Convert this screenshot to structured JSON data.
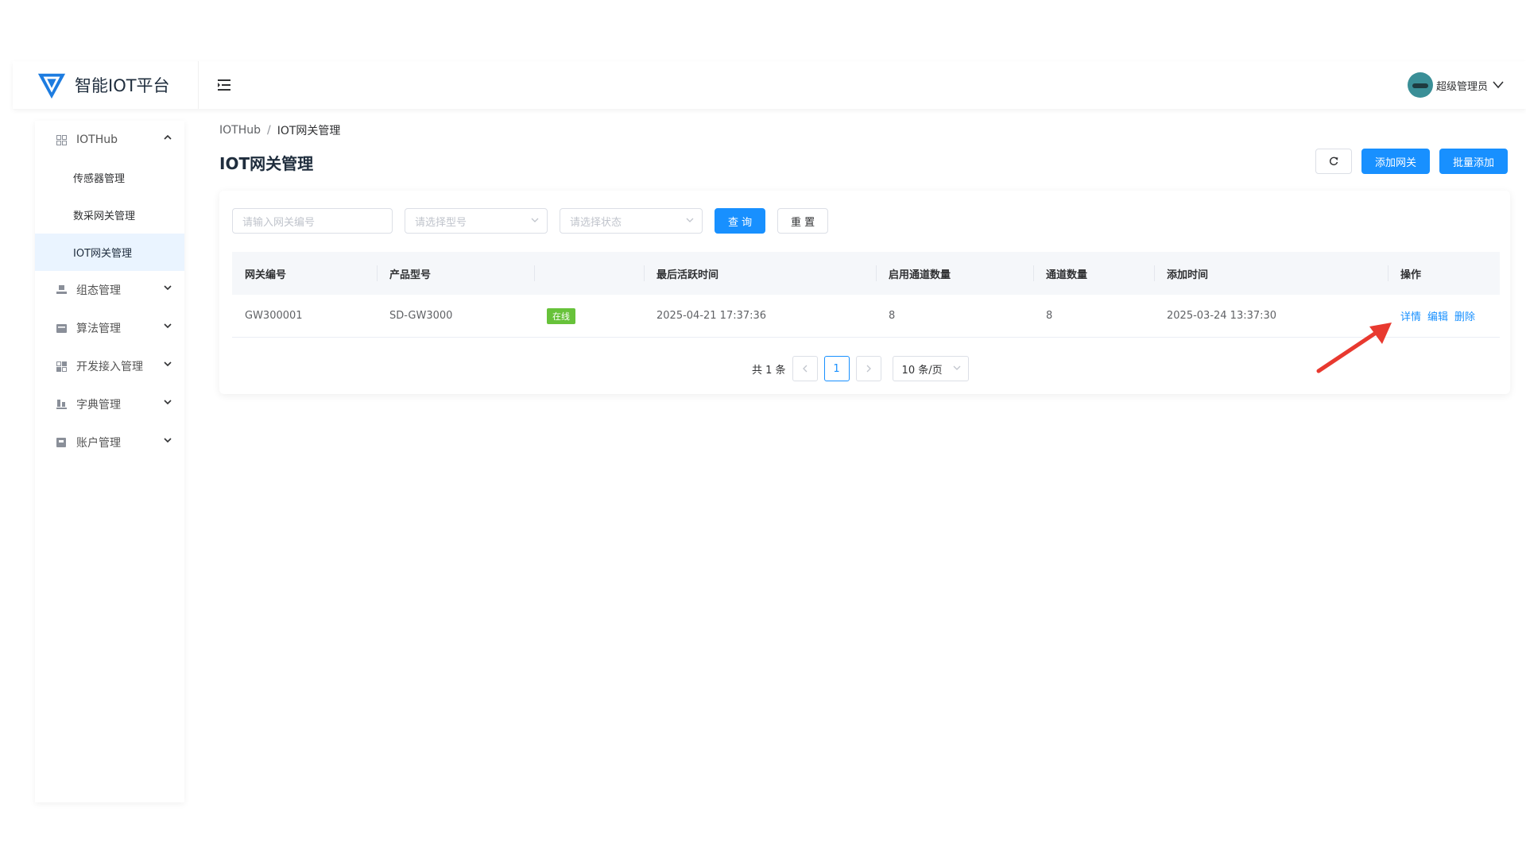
{
  "app": {
    "title": "智能IOT平台",
    "user_name": "超级管理员"
  },
  "sidebar": {
    "groups": [
      {
        "label": "IOTHub",
        "icon": "grid-icon",
        "expanded": true,
        "items": [
          {
            "label": "传感器管理"
          },
          {
            "label": "数采网关管理"
          },
          {
            "label": "IOT网关管理",
            "active": true
          }
        ]
      },
      {
        "label": "组态管理",
        "icon": "monitor-icon"
      },
      {
        "label": "算法管理",
        "icon": "card-icon"
      },
      {
        "label": "开发接入管理",
        "icon": "qrcode-icon"
      },
      {
        "label": "字典管理",
        "icon": "chart-icon"
      },
      {
        "label": "账户管理",
        "icon": "account-icon"
      }
    ]
  },
  "breadcrumb": {
    "root": "IOTHub",
    "separator": "/",
    "current": "IOT网关管理"
  },
  "page": {
    "title": "IOT网关管理",
    "add_gateway_label": "添加网关",
    "batch_add_label": "批量添加"
  },
  "filters": {
    "gateway_no_placeholder": "请输入网关编号",
    "model_placeholder": "请选择型号",
    "status_placeholder": "请选择状态",
    "query_label": "查 询",
    "reset_label": "重 置"
  },
  "table": {
    "headers": [
      "网关编号",
      "产品型号",
      "",
      "最后活跃时间",
      "启用通道数量",
      "通道数量",
      "添加时间",
      "操作"
    ],
    "rows": [
      {
        "gateway_no": "GW300001",
        "model": "SD-GW3000",
        "status": "在线",
        "last_active": "2025-04-21 17:37:36",
        "enabled_channels": "8",
        "channels": "8",
        "added_at": "2025-03-24 13:37:30",
        "ops": [
          "详情",
          "编辑",
          "删除"
        ]
      }
    ]
  },
  "pagination": {
    "total_text": "共 1 条",
    "current_page": "1",
    "page_size": "10 条/页"
  },
  "colors": {
    "primary": "#1890ff",
    "status_online": "#67c23a",
    "annotation_arrow": "#e8392f"
  }
}
